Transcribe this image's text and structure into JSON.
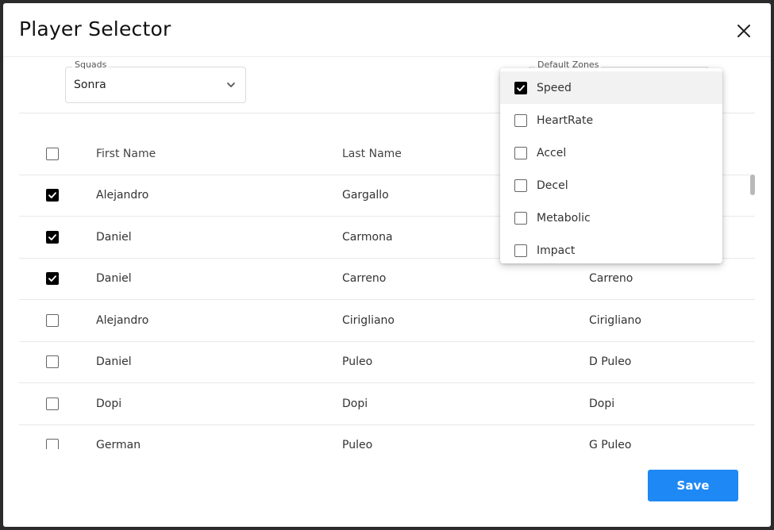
{
  "dialog": {
    "title": "Player Selector"
  },
  "filters": {
    "squads_label": "Squads",
    "squads_value": "Sonra",
    "zones_label": "Default Zones"
  },
  "zones_menu": {
    "options": [
      {
        "label": "Speed",
        "checked": true
      },
      {
        "label": "HeartRate",
        "checked": false
      },
      {
        "label": "Accel",
        "checked": false
      },
      {
        "label": "Decel",
        "checked": false
      },
      {
        "label": "Metabolic",
        "checked": false
      },
      {
        "label": "Impact",
        "checked": false
      }
    ]
  },
  "table": {
    "headers": {
      "first_name": "First Name",
      "last_name": "Last Name"
    },
    "rows": [
      {
        "first": "Alejandro",
        "last": "Gargallo",
        "display": "",
        "checked": true
      },
      {
        "first": "Daniel",
        "last": "Carmona",
        "display": "",
        "checked": true
      },
      {
        "first": "Daniel",
        "last": "Carreno",
        "display": "Carreno",
        "checked": true
      },
      {
        "first": "Alejandro",
        "last": "Cirigliano",
        "display": "Cirigliano",
        "checked": false
      },
      {
        "first": "Daniel",
        "last": "Puleo",
        "display": "D Puleo",
        "checked": false
      },
      {
        "first": "Dopi",
        "last": "Dopi",
        "display": "Dopi",
        "checked": false
      },
      {
        "first": "German",
        "last": "Puleo",
        "display": "G Puleo",
        "checked": false
      }
    ]
  },
  "footer": {
    "save_label": "Save"
  },
  "colors": {
    "accent": "#1e88f5",
    "check": "#000000"
  },
  "icons": {
    "close": "close-icon",
    "squads_dropdown": "chevron-down-icon",
    "checkbox_checked": "check-icon"
  }
}
